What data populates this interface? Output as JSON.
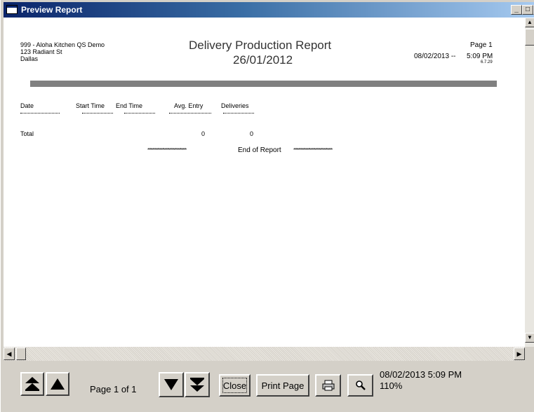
{
  "window": {
    "title": "Preview Report"
  },
  "report": {
    "company_line1": "999 - Aloha Kitchen QS Demo",
    "company_line2": "123 Radiant St",
    "company_line3": "Dallas",
    "title": "Delivery Production Report",
    "date": "26/01/2012",
    "page_label": "Page 1",
    "print_date": "08/02/2013 --",
    "print_time": "5:09 PM",
    "version": "6.7.29",
    "columns": [
      "Date",
      "Start Time",
      "End Time",
      "Avg. Entry",
      "Deliveries"
    ],
    "total_label": "Total",
    "total_avg_entry": "0",
    "total_deliveries": "0",
    "end_stars_left": "********************************",
    "end_text": "End of Report",
    "end_stars_right": "********************************"
  },
  "toolbar": {
    "page_info": "Page 1 of 1",
    "close_label": "Close",
    "print_page_label": "Print Page",
    "status_datetime": "08/02/2013  5:09 PM",
    "zoom": "110%"
  }
}
